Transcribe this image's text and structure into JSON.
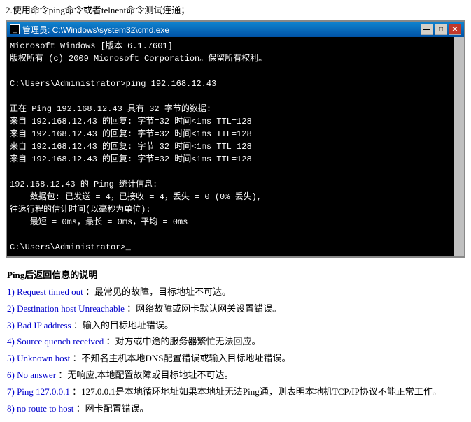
{
  "instruction": {
    "text": "2.使用命令ping命令或者telnent命令测试连通；"
  },
  "cmd_window": {
    "title": "管理员: C:\\Windows\\system32\\cmd.exe",
    "lines": [
      "Microsoft Windows [版本 6.1.7601]",
      "版权所有 (c) 2009 Microsoft Corporation。保留所有权利。",
      "",
      "C:\\Users\\Administrator>ping 192.168.12.43",
      "",
      "正在 Ping 192.168.12.43 具有 32 字节的数据:",
      "来自 192.168.12.43 的回复: 字节=32 时间<1ms TTL=128",
      "来自 192.168.12.43 的回复: 字节=32 时间<1ms TTL=128",
      "来自 192.168.12.43 的回复: 字节=32 时间<1ms TTL=128",
      "来自 192.168.12.43 的回复: 字节=32 时间<1ms TTL=128",
      "",
      "192.168.12.43 的 Ping 统计信息:",
      "    数据包: 已发送 = 4，已接收 = 4，丢失 = 0 (0% 丢失),",
      "往返行程的估计时间(以毫秒为单位):",
      "    最短 = 0ms，最长 = 0ms，平均 = 0ms",
      "",
      "C:\\Users\\Administrator>_"
    ],
    "buttons": {
      "minimize": "—",
      "maximize": "□",
      "close": "✕"
    }
  },
  "ping_info": {
    "title": "Ping后返回信息的说明",
    "items": [
      {
        "number": "1)",
        "label": "Request timed out",
        "desc": "：最常见的故障，目标地址不可达。"
      },
      {
        "number": "2)",
        "label": "Destination host Unreachable",
        "desc": "：网络故障或网卡默认网关设置错误。"
      },
      {
        "number": "3)",
        "label": "Bad IP address",
        "desc": "：输入的目标地址错误。"
      },
      {
        "number": "4)",
        "label": "Source quench received",
        "desc": "：对方或中途的服务器繁忙无法回应。"
      },
      {
        "number": "5)",
        "label": "Unknown host",
        "desc": "：不知名主机本地DNS配置错误或输入目标地址错误。"
      },
      {
        "number": "6)",
        "label": "No answer",
        "desc": "：无响应,本地配置故障或目标地址不可达。"
      },
      {
        "number": "7)",
        "label": "Ping 127.0.0.1",
        "desc": "：127.0.0.1是本地循环地址如果本地址无法Ping通，则表明本地机TCP/IP协议不能正常工作。"
      },
      {
        "number": "8)",
        "label": "no route to host",
        "desc": "：网卡配置错误。"
      }
    ]
  }
}
